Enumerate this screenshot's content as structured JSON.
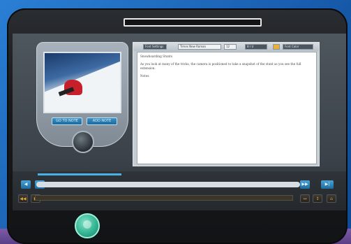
{
  "video": {
    "btn_left": "GO TO NOTE",
    "btn_right": "ADD NOTE"
  },
  "editor": {
    "toolbar": {
      "button1": "Font Settings",
      "font": "Times New Roman",
      "size": "12",
      "buttons": "B  I  U",
      "color": "Font Color"
    },
    "heading": "Snowboarding Stunts",
    "paragraph": "As you look at many of the tricks, the camera is positioned to take a snapshot of the stunt as you see the full extension.",
    "note": "Notes"
  },
  "controls": {
    "row1": {
      "left_icon": "◀",
      "skip_icon": "◀◀",
      "right_icon": "▶▶",
      "end_icon": "▶|"
    },
    "row2": {
      "a": "◀◀",
      "b": "▶",
      "c": "↔",
      "d": "↕",
      "e": "⌂"
    }
  },
  "colors": {
    "accent": "#4ab1e6",
    "home": "#2fb08e"
  }
}
